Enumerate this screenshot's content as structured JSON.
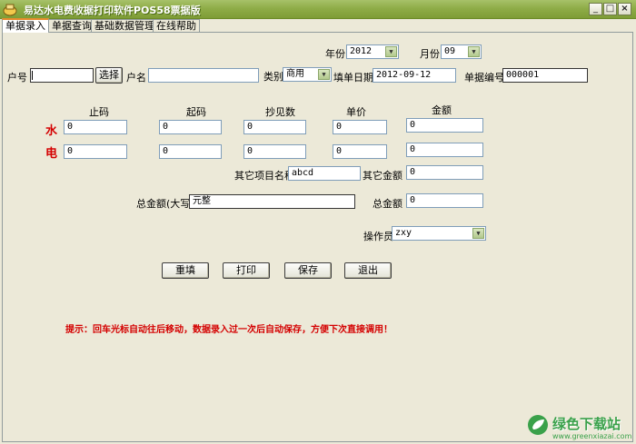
{
  "window": {
    "title": "易达水电费收据打印软件POS58票据版",
    "minimize": "_",
    "maximize": "□",
    "close": "×"
  },
  "tabs": [
    {
      "label": "单据录入"
    },
    {
      "label": "单据查询"
    },
    {
      "label": "基础数据管理"
    },
    {
      "label": "在线帮助"
    }
  ],
  "form": {
    "year_label": "年份",
    "year_value": "2012",
    "month_label": "月份",
    "month_value": "09",
    "account_label": "户号",
    "account_value": "",
    "select_button": "选择",
    "name_label": "户名",
    "name_value": "",
    "category_label": "类别",
    "category_value": "商用",
    "date_label": "填单日期",
    "date_value": "2012-09-12",
    "doc_no_label": "单据编号",
    "doc_no_value": "000001",
    "col_end": "止码",
    "col_start": "起码",
    "col_ratio": "抄见数",
    "col_price": "单价",
    "col_amount": "金额",
    "water_label": "水",
    "elec_label": "电",
    "water": {
      "end": "0",
      "start": "0",
      "ratio": "0",
      "price": "0",
      "amount": "0"
    },
    "elec": {
      "end": "0",
      "start": "0",
      "ratio": "0",
      "price": "0",
      "amount": "0"
    },
    "other_name_label": "其它项目名称",
    "other_name_value": "abcd",
    "other_amount_label": "其它金额",
    "other_amount_value": "0",
    "total_upper_label": "总金额(大写)",
    "total_upper_value": "元整",
    "total_label": "总金额",
    "total_value": "0",
    "operator_label": "操作员",
    "operator_value": "zxy"
  },
  "buttons": {
    "reset": "重填",
    "print": "打印",
    "save": "保存",
    "exit": "退出"
  },
  "tip": "提示：回车光标自动往后移动，数据录入过一次后自动保存，方便下次直接调用！",
  "watermark": {
    "brand": "绿色下载站",
    "url": "www.greenxiazai.com"
  },
  "colors": {
    "titlebar": "#8fad48",
    "window_bg": "#ece9d8",
    "accent_red": "#d40000",
    "watermark_green": "#3aa14a"
  }
}
